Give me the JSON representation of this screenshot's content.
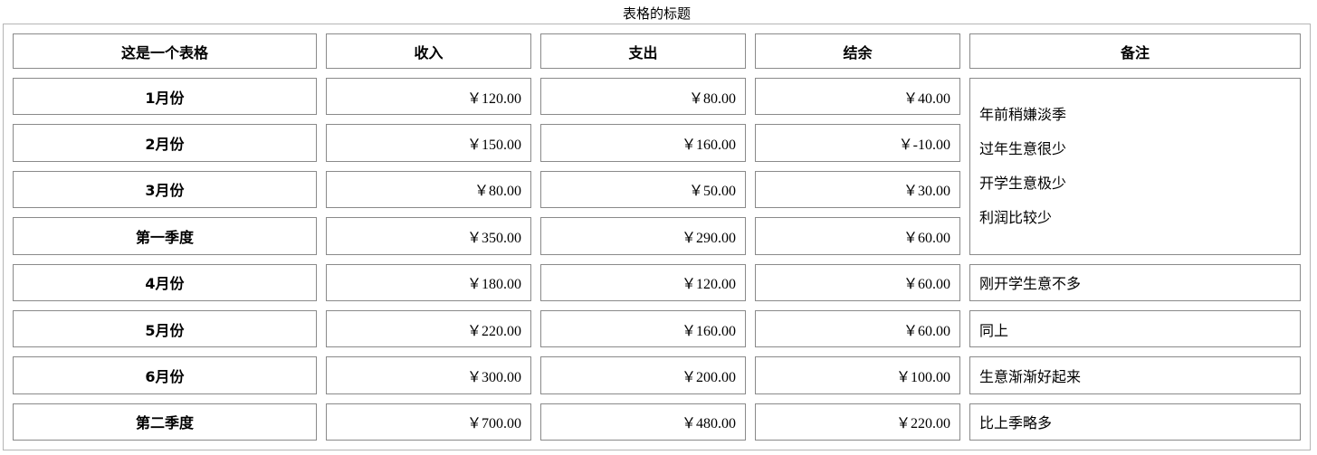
{
  "caption": "表格的标题",
  "headers": [
    "这是一个表格",
    "收入",
    "支出",
    "结余",
    "备注"
  ],
  "rows": [
    {
      "label": "1月份",
      "income": "￥120.00",
      "expense": "￥80.00",
      "balance": "￥40.00"
    },
    {
      "label": "2月份",
      "income": "￥150.00",
      "expense": "￥160.00",
      "balance": "￥-10.00"
    },
    {
      "label": "3月份",
      "income": "￥80.00",
      "expense": "￥50.00",
      "balance": "￥30.00"
    },
    {
      "label": "第一季度",
      "income": "￥350.00",
      "expense": "￥290.00",
      "balance": "￥60.00"
    },
    {
      "label": "4月份",
      "income": "￥180.00",
      "expense": "￥120.00",
      "balance": "￥60.00",
      "note": "刚开学生意不多"
    },
    {
      "label": "5月份",
      "income": "￥220.00",
      "expense": "￥160.00",
      "balance": "￥60.00",
      "note": "同上"
    },
    {
      "label": "6月份",
      "income": "￥300.00",
      "expense": "￥200.00",
      "balance": "￥100.00",
      "note": "生意渐渐好起来"
    },
    {
      "label": "第二季度",
      "income": "￥700.00",
      "expense": "￥480.00",
      "balance": "￥220.00",
      "note": "比上季略多"
    }
  ],
  "merged_note_lines": [
    "年前稍嫌淡季",
    "过年生意很少",
    "开学生意极少",
    "利润比较少"
  ]
}
